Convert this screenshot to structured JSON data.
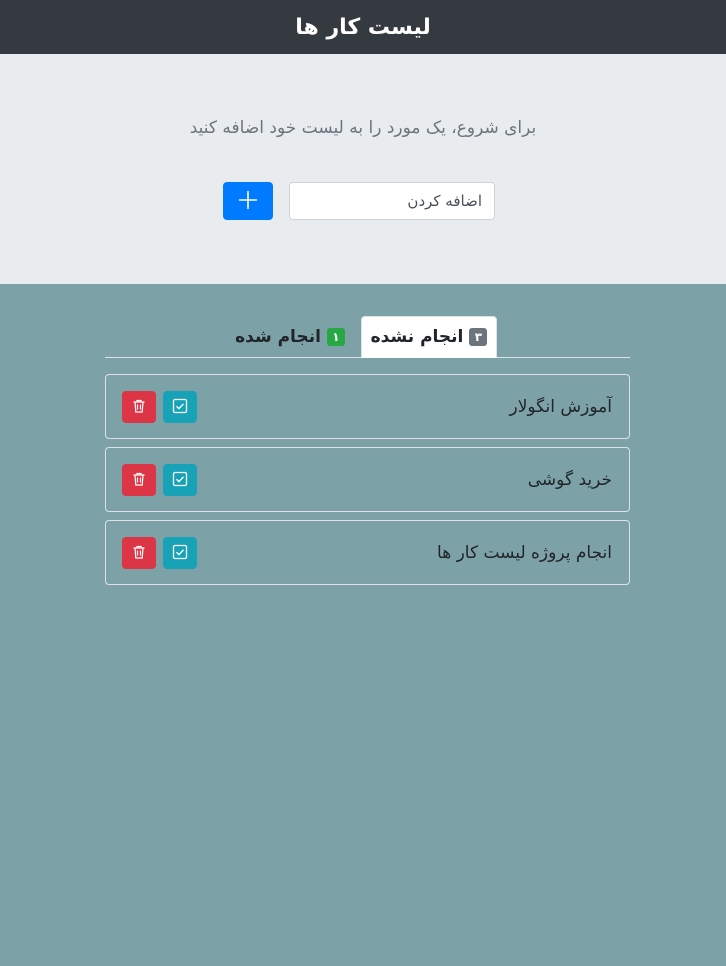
{
  "header": {
    "title": "لیست کار ها"
  },
  "hero": {
    "prompt": "برای شروع، یک مورد را به لیست خود اضافه کنید",
    "input": {
      "placeholder": "اضافه کردن",
      "value": ""
    },
    "add_button_icon": "plus-icon"
  },
  "tabs": [
    {
      "label": "انجام نشده",
      "count": "۳",
      "active": true,
      "badge_color": "#6c757d"
    },
    {
      "label": "انجام شده",
      "count": "۱",
      "active": false,
      "badge_color": "#28a745"
    }
  ],
  "tasks": [
    {
      "text": "آموزش انگولار"
    },
    {
      "text": "خرید گوشی"
    },
    {
      "text": "انجام پروژه لیست کار ها"
    }
  ],
  "colors": {
    "header_bg": "#343a40",
    "hero_bg": "#e9ecef",
    "page_bg": "#7ca2a8",
    "primary": "#007bff",
    "danger": "#dc3545",
    "info": "#17a2b8"
  }
}
